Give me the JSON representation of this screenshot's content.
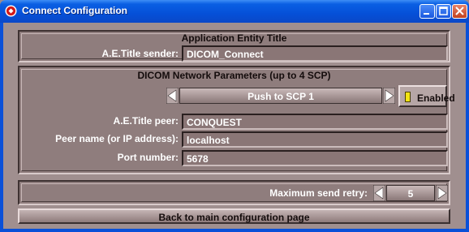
{
  "window": {
    "title": "Connect Configuration"
  },
  "ae_section": {
    "heading": "Application Entity Title",
    "sender_label": "A.E.Title sender:",
    "sender_value": "DICOM_Connect"
  },
  "network_section": {
    "heading": "DICOM Network Parameters (up to 4 SCP)",
    "scp_selector": "Push to SCP 1",
    "enabled_label": "Enabled",
    "peer_label": "A.E.Title peer:",
    "peer_value": "CONQUEST",
    "peer_name_label": "Peer name (or IP address):",
    "peer_name_value": "localhost",
    "port_label": "Port number:",
    "port_value": "5678"
  },
  "retry": {
    "label": "Maximum send retry:",
    "value": "5"
  },
  "back_button": "Back to main configuration page"
}
